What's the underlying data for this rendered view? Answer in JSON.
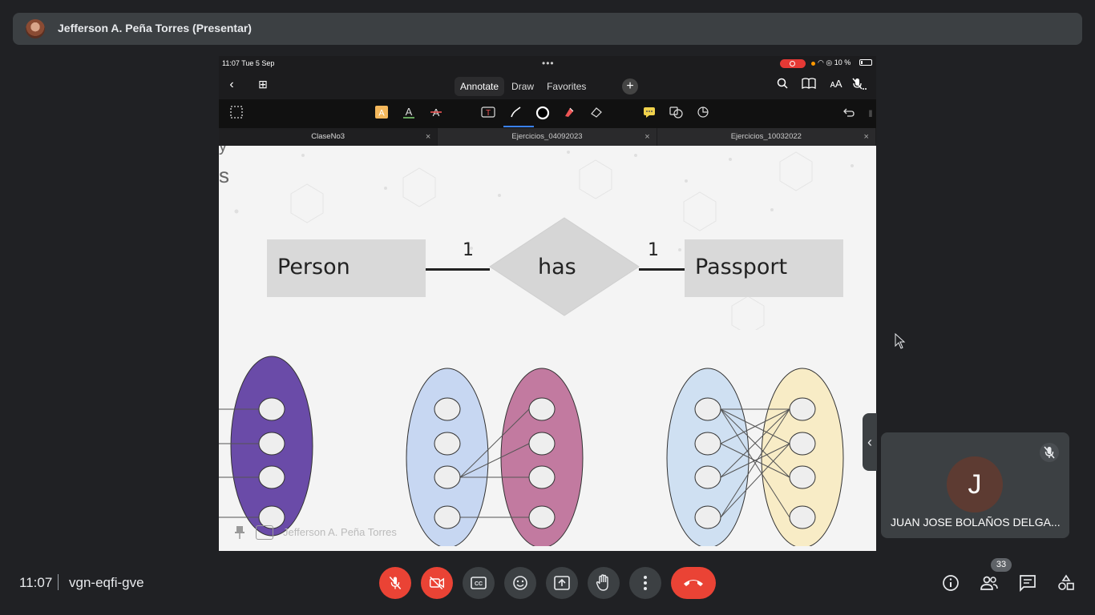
{
  "presenter": {
    "name": "Jefferson A. Peña Torres (Presentar)"
  },
  "shared_screen": {
    "status_bar": {
      "time_date": "11:07  Tue 5 Sep",
      "dots": "•••",
      "battery_text": "10 %"
    },
    "mode_tabs": [
      "Annotate",
      "Draw",
      "Favorites"
    ],
    "active_mode": "Annotate",
    "doc_tabs": [
      {
        "label": "ClaseNo3",
        "active": true
      },
      {
        "label": "Ejercicios_04092023",
        "active": false
      },
      {
        "label": "Ejercicios_10032022",
        "active": false
      }
    ],
    "page": {
      "corner_text_top": "y",
      "corner_text": "s",
      "er_diagram": {
        "entity_left": "Person",
        "relationship": "has",
        "entity_right": "Passport",
        "cardinality_left": "1",
        "cardinality_right": "1"
      }
    },
    "watermark_name": "Jefferson A. Peña Torres"
  },
  "participant": {
    "initial": "J",
    "name": "JUAN JOSE BOLAÑOS DELGA..."
  },
  "meeting": {
    "time": "11:07",
    "code": "vgn-eqfi-gve",
    "people_count": "33"
  },
  "colors": {
    "hangup": "#ea4335",
    "tile": "#3c4043",
    "background": "#202124"
  }
}
